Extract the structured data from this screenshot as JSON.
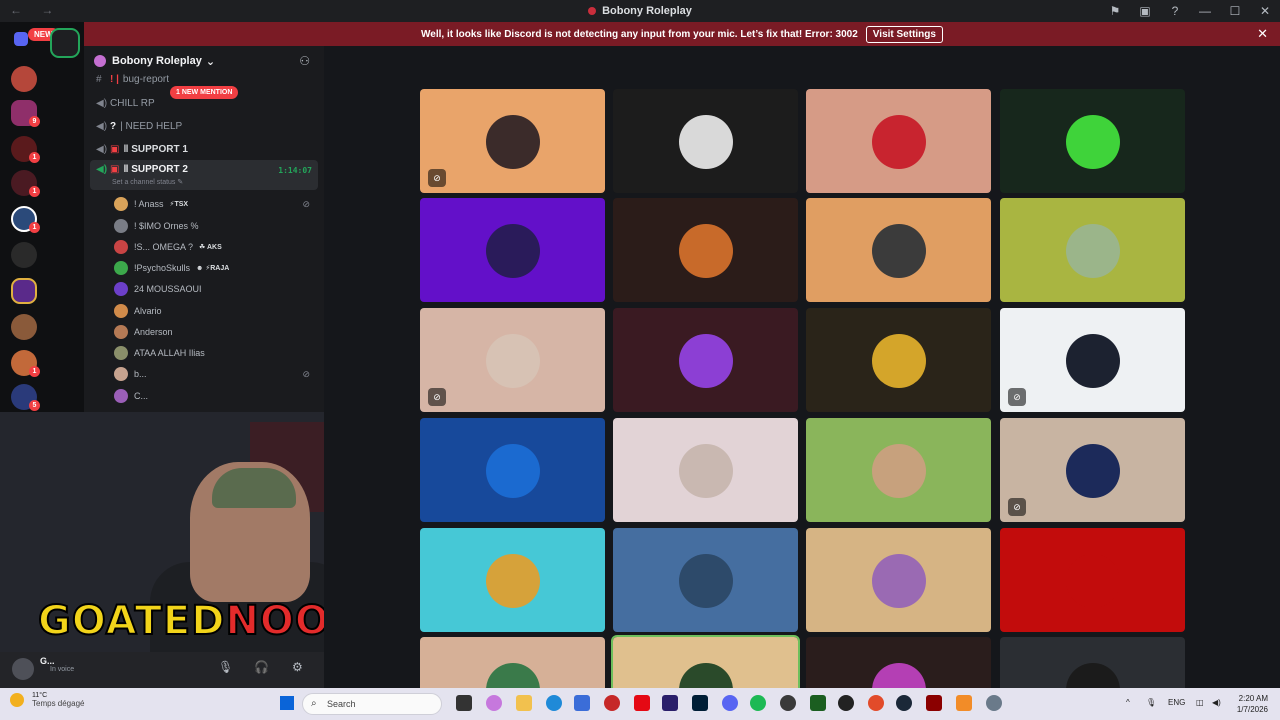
{
  "window": {
    "title": "Bobony Roleplay",
    "nav_arrows": "← →",
    "controls": [
      "⚑",
      "▣",
      "?",
      "—",
      "☐",
      "✕"
    ]
  },
  "banner": {
    "text": "Well, it looks like Discord is not detecting any input from your mic. Let’s fix that!",
    "error": "Error: 3002",
    "button": "Visit Settings",
    "close": "✕"
  },
  "servers": {
    "new_label": "NEW",
    "badges": [
      "9",
      "1",
      "1",
      "1",
      "1",
      "1",
      "5"
    ]
  },
  "guild": {
    "name": "Bobony Roleplay",
    "chevron": "⌄",
    "mention_badge": "1 NEW MENTION"
  },
  "channels": [
    {
      "prefix": "! |",
      "name": "bug-report"
    },
    {
      "prefix": "",
      "name": "CHILL RP"
    },
    {
      "prefix": "?",
      "name": "| NEED HELP"
    },
    {
      "prefix": "▣",
      "name": "ǁ SUPPORT 1"
    },
    {
      "prefix": "▣",
      "name": "ǁ SUPPORT 2",
      "timer": "1:14:07",
      "status": "Set a channel status ✎"
    }
  ],
  "members": [
    {
      "name": "! Anass",
      "tag": "⚡TSX",
      "color": "#d9a35a"
    },
    {
      "name": "! $IMO Ornes %",
      "tag": "",
      "color": "#7a7d86"
    },
    {
      "name": "!S... OMEGA ?",
      "tag": "☘ AKS",
      "color": "#c94444"
    },
    {
      "name": "!PsychoSkulls",
      "tag": "☻ ⚡RAJA",
      "color": "#3ca84b"
    },
    {
      "name": "24 MOUSSAOUI",
      "tag": "",
      "color": "#6c3fc9"
    },
    {
      "name": "Alvario",
      "tag": "",
      "color": "#d18b4a"
    },
    {
      "name": "Anderson",
      "tag": "",
      "color": "#b57a55"
    },
    {
      "name": "ATAA ALLAH Ilias",
      "tag": "",
      "color": "#8a8f6a"
    },
    {
      "name": "b...",
      "tag": "",
      "color": "#c7a38f"
    },
    {
      "name": "C...",
      "tag": "",
      "color": "#9b5fb8"
    }
  ],
  "overlay": {
    "part_a": "GOATED",
    "part_b": "NOOBIE"
  },
  "user": {
    "name": "G...",
    "status": "In voice"
  },
  "tiles": [
    {
      "bg": "#e9a46a",
      "pfp": "#3b2b2a",
      "muted": true
    },
    {
      "bg": "#1c1c1c",
      "pfp": "#d9d9d9",
      "muted": false
    },
    {
      "bg": "#d69b86",
      "pfp": "#c8242f",
      "muted": false
    },
    {
      "bg": "#17271c",
      "pfp": "#3fd33a",
      "muted": false
    },
    {
      "bg": "#6310c9",
      "pfp": "#2a1b5a",
      "muted": false
    },
    {
      "bg": "#2b1c19",
      "pfp": "#c86a2a",
      "muted": false
    },
    {
      "bg": "#e09e62",
      "pfp": "#3b3b3b",
      "muted": false
    },
    {
      "bg": "#a9b541",
      "pfp": "#9bb58a",
      "muted": false
    },
    {
      "bg": "#d6b5a6",
      "pfp": "#d7c2b4",
      "muted": true
    },
    {
      "bg": "#3a1a22",
      "pfp": "#8c3fd4",
      "muted": false
    },
    {
      "bg": "#2a2419",
      "pfp": "#d4a52a",
      "muted": false
    },
    {
      "bg": "#eef1f3",
      "pfp": "#1c2230",
      "muted": true
    },
    {
      "bg": "#17499b",
      "pfp": "#1b6ad0",
      "muted": false
    },
    {
      "bg": "#e2d3d6",
      "pfp": "#c9b8b1",
      "muted": false
    },
    {
      "bg": "#8ab55b",
      "pfp": "#c7a17d",
      "muted": false
    },
    {
      "bg": "#c8b4a2",
      "pfp": "#1c2a5a",
      "muted": true
    },
    {
      "bg": "#46c8d6",
      "pfp": "#d6a23a",
      "muted": false
    },
    {
      "bg": "#456ea0",
      "pfp": "#2d4a6a",
      "muted": false
    },
    {
      "bg": "#d6b484",
      "pfp": "#9a6ab3",
      "muted": false
    },
    {
      "bg": "#c20c0c",
      "pfp": "#c20c0c",
      "muted": false
    },
    {
      "bg": "#d6b097",
      "pfp": "#3a7a4a",
      "muted": false
    },
    {
      "bg": "#e0c08e",
      "pfp": "#2a4a2a",
      "muted": false
    },
    {
      "bg": "#2a1d1c",
      "pfp": "#b43fb4",
      "muted": false
    },
    {
      "bg": "#2b2e33",
      "pfp": "#1b1b1b",
      "muted": false
    }
  ],
  "taskbar": {
    "temp": "11°C",
    "weather": "Temps dégagé",
    "search_placeholder": "Search",
    "lang": "ENG",
    "time": "2:20 AM",
    "date": "1/7/2026"
  }
}
